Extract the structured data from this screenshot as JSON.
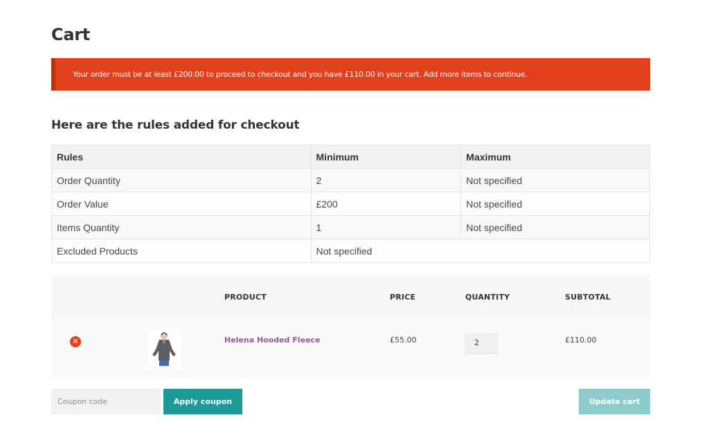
{
  "page": {
    "title": "Cart"
  },
  "notice": {
    "message": "Your order must be at least £200.00 to proceed to checkout and you have £110.00 in your cart. Add more items to continue.",
    "color": "#e2401c"
  },
  "rules": {
    "heading": "Here are the rules added for checkout",
    "headers": {
      "rules": "Rules",
      "minimum": "Minimum",
      "maximum": "Maximum"
    },
    "rows": [
      {
        "rule": "Order Quantity",
        "minimum": "2",
        "maximum": "Not specified"
      },
      {
        "rule": "Order Value",
        "minimum": "£200",
        "maximum": "Not specified"
      },
      {
        "rule": "Items Quantity",
        "minimum": "1",
        "maximum": "Not specified"
      },
      {
        "rule": "Excluded Products",
        "value": "Not specified"
      }
    ]
  },
  "cart": {
    "columns": {
      "product": "PRODUCT",
      "price": "PRICE",
      "quantity": "QUANTITY",
      "subtotal": "SUBTOTAL"
    },
    "items": [
      {
        "remove_icon": "remove-circle-icon",
        "thumbnail": "hooded-fleece-image",
        "name": "Helena Hooded Fleece",
        "price": "£55.00",
        "quantity": "2",
        "subtotal": "£110.00"
      }
    ],
    "coupon_placeholder": "Coupon code",
    "apply_coupon_label": "Apply coupon",
    "update_cart_label": "Update cart",
    "accent_color": "#1c9998",
    "link_color": "#96588a"
  }
}
